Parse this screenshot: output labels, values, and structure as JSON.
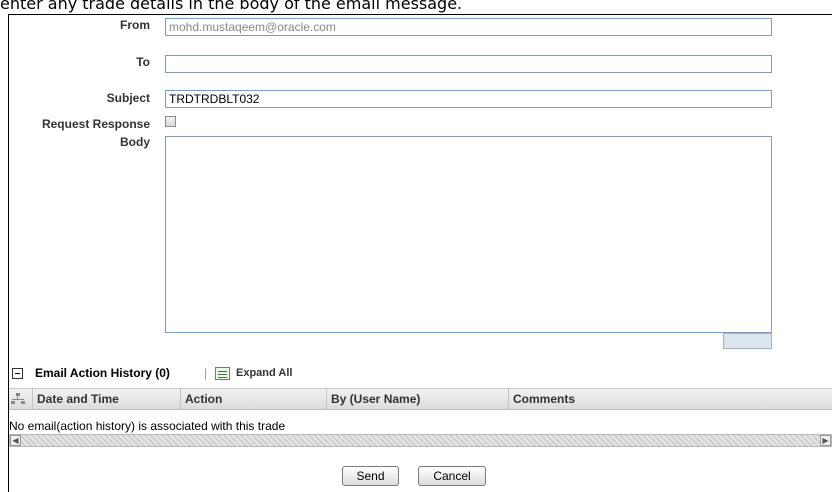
{
  "instruction_text": "enter any trade details in the body of the email message.",
  "form": {
    "from_label": "From",
    "from_value": "mohd.mustaqeem@oracle.com",
    "to_label": "To",
    "to_value": "",
    "subject_label": "Subject",
    "subject_value": "TRDTRDBLT032",
    "request_response_label": "Request Response",
    "request_response_checked": false,
    "body_label": "Body",
    "body_value": ""
  },
  "history": {
    "title": "Email Action History (0)",
    "separator": "|",
    "expand_all": "Expand All",
    "columns": [
      "Date and Time",
      "Action",
      "By (User Name)",
      "Comments"
    ],
    "empty_message": "No email(action history) is associated with this trade"
  },
  "buttons": {
    "send": "Send",
    "cancel": "Cancel"
  },
  "icons": [
    "collapse-icon",
    "expand-all-icon",
    "tree-icon",
    "scroll-left-icon",
    "scroll-right-icon"
  ]
}
